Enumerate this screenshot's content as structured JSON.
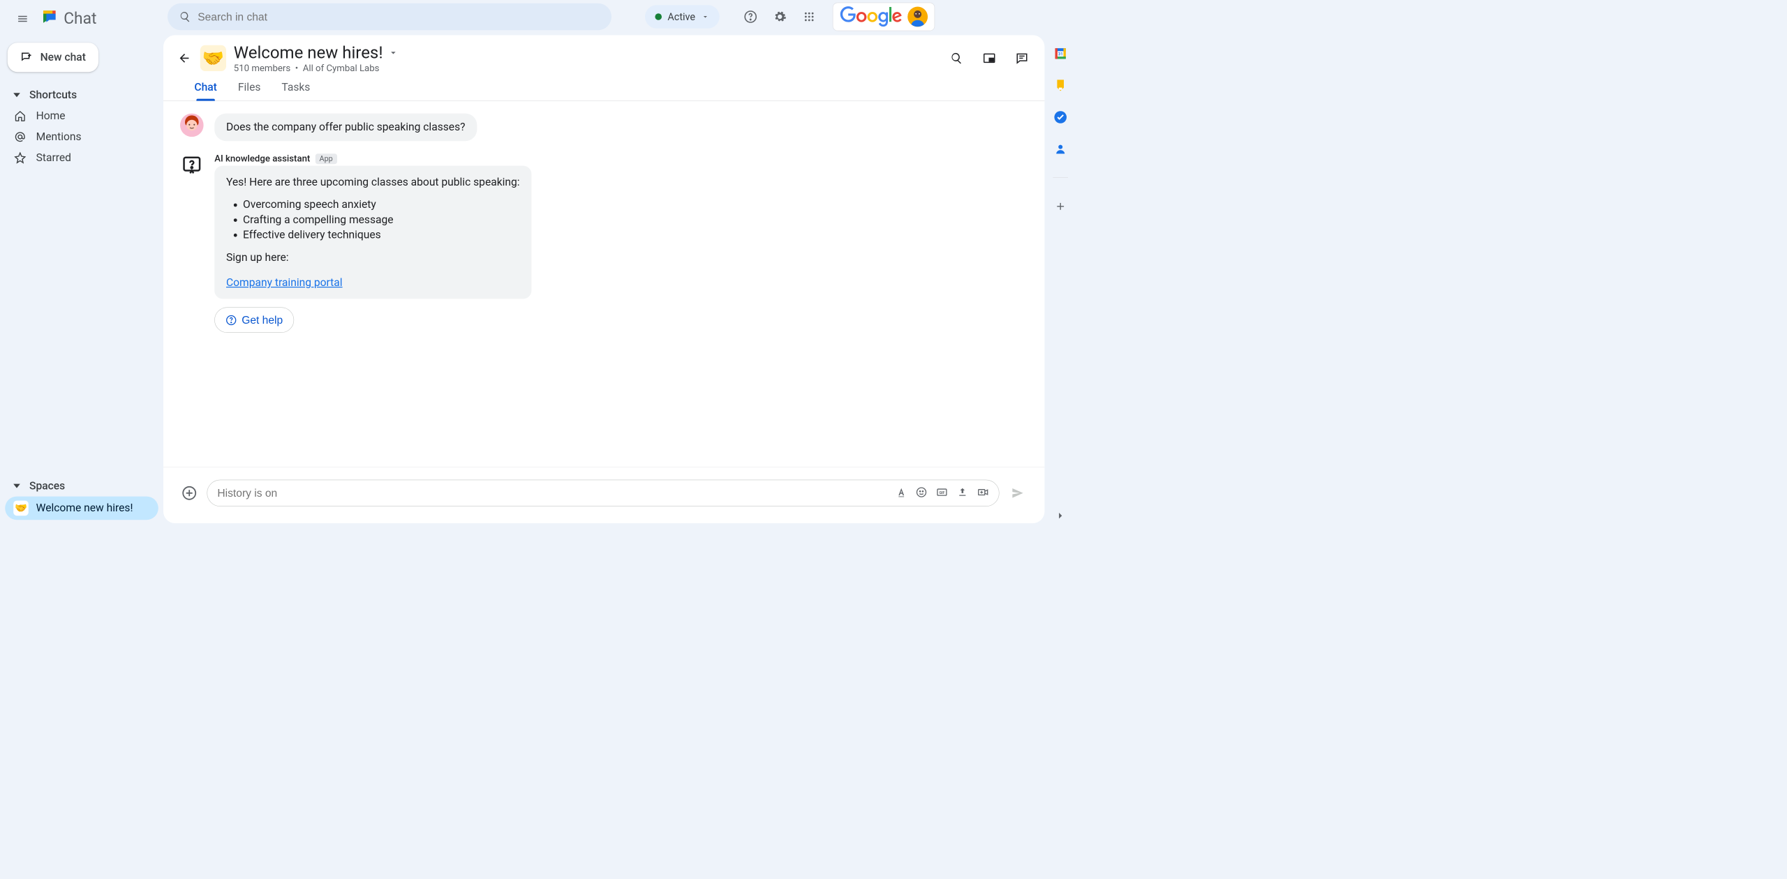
{
  "app_name": "Chat",
  "search": {
    "placeholder": "Search in chat"
  },
  "status": {
    "label": "Active"
  },
  "new_chat_label": "New chat",
  "sections": {
    "shortcuts": {
      "label": "Shortcuts",
      "items": [
        {
          "label": "Home"
        },
        {
          "label": "Mentions"
        },
        {
          "label": "Starred"
        }
      ]
    },
    "spaces": {
      "label": "Spaces",
      "items": [
        {
          "label": "Welcome new hires!",
          "emoji": "🤝"
        }
      ]
    }
  },
  "space": {
    "title": "Welcome new hires!",
    "emoji": "🤝",
    "members_text": "510 members",
    "separator": "•",
    "audience": "All of Cymbal Labs"
  },
  "tabs": [
    {
      "label": "Chat",
      "active": true
    },
    {
      "label": "Files"
    },
    {
      "label": "Tasks"
    }
  ],
  "messages": {
    "user_question": "Does the company offer public speaking classes?",
    "assistant": {
      "name": "AI knowledge assistant",
      "badge": "App",
      "intro": "Yes! Here are three upcoming classes about public speaking:",
      "bullets": [
        "Overcoming speech anxiety",
        "Crafting a compelling message",
        "Effective delivery techniques"
      ],
      "signup_text": "Sign up here:",
      "link_text": "Company training portal",
      "help_button": "Get help"
    }
  },
  "compose": {
    "placeholder": "History is on"
  },
  "google_wordmark": "Google"
}
